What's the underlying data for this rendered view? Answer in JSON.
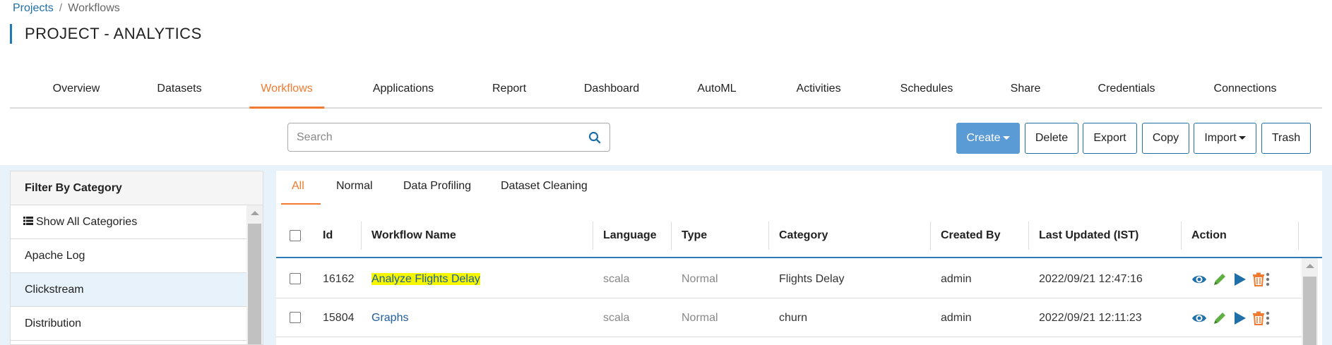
{
  "breadcrumb": {
    "projects": "Projects",
    "separator": "/",
    "current": "Workflows"
  },
  "page_title": "PROJECT - ANALYTICS",
  "main_tabs": [
    {
      "label": "Overview"
    },
    {
      "label": "Datasets"
    },
    {
      "label": "Workflows",
      "active": true
    },
    {
      "label": "Applications"
    },
    {
      "label": "Report"
    },
    {
      "label": "Dashboard"
    },
    {
      "label": "AutoML"
    },
    {
      "label": "Activities"
    },
    {
      "label": "Schedules"
    },
    {
      "label": "Share"
    },
    {
      "label": "Credentials"
    },
    {
      "label": "Connections"
    }
  ],
  "search": {
    "placeholder": "Search",
    "value": ""
  },
  "toolbar": {
    "create": "Create",
    "delete": "Delete",
    "export": "Export",
    "copy": "Copy",
    "import": "Import",
    "trash": "Trash"
  },
  "sidebar": {
    "header": "Filter By Category",
    "show_all": "Show All Categories",
    "items": [
      {
        "label": "Apache Log"
      },
      {
        "label": "Clickstream",
        "selected": true
      },
      {
        "label": "Distribution"
      }
    ]
  },
  "sub_tabs": [
    {
      "label": "All",
      "active": true
    },
    {
      "label": "Normal"
    },
    {
      "label": "Data Profiling"
    },
    {
      "label": "Dataset Cleaning"
    }
  ],
  "table": {
    "columns": [
      "Id",
      "Workflow Name",
      "Language",
      "Type",
      "Category",
      "Created By",
      "Last Updated (IST)",
      "Action"
    ],
    "rows": [
      {
        "id": "16162",
        "name": "Analyze Flights Delay",
        "language": "scala",
        "type": "Normal",
        "category": "Flights Delay",
        "created_by": "admin",
        "last_updated": "2022/09/21 12:47:16",
        "highlighted": true
      },
      {
        "id": "15804",
        "name": "Graphs",
        "language": "scala",
        "type": "Normal",
        "category": "churn",
        "created_by": "admin",
        "last_updated": "2022/09/21 12:11:23",
        "highlighted": false
      }
    ]
  },
  "colors": {
    "accent": "#f07b30",
    "link": "#1f5ea0",
    "primary_button": "#5b9bd5",
    "highlight": "#f5f500",
    "content_bg": "#e8f2fb"
  },
  "icons": {
    "search": "search-icon",
    "view": "eye-icon",
    "edit": "pencil-icon",
    "run": "play-icon",
    "delete": "trash-icon",
    "more": "kebab-icon",
    "list": "list-icon"
  }
}
